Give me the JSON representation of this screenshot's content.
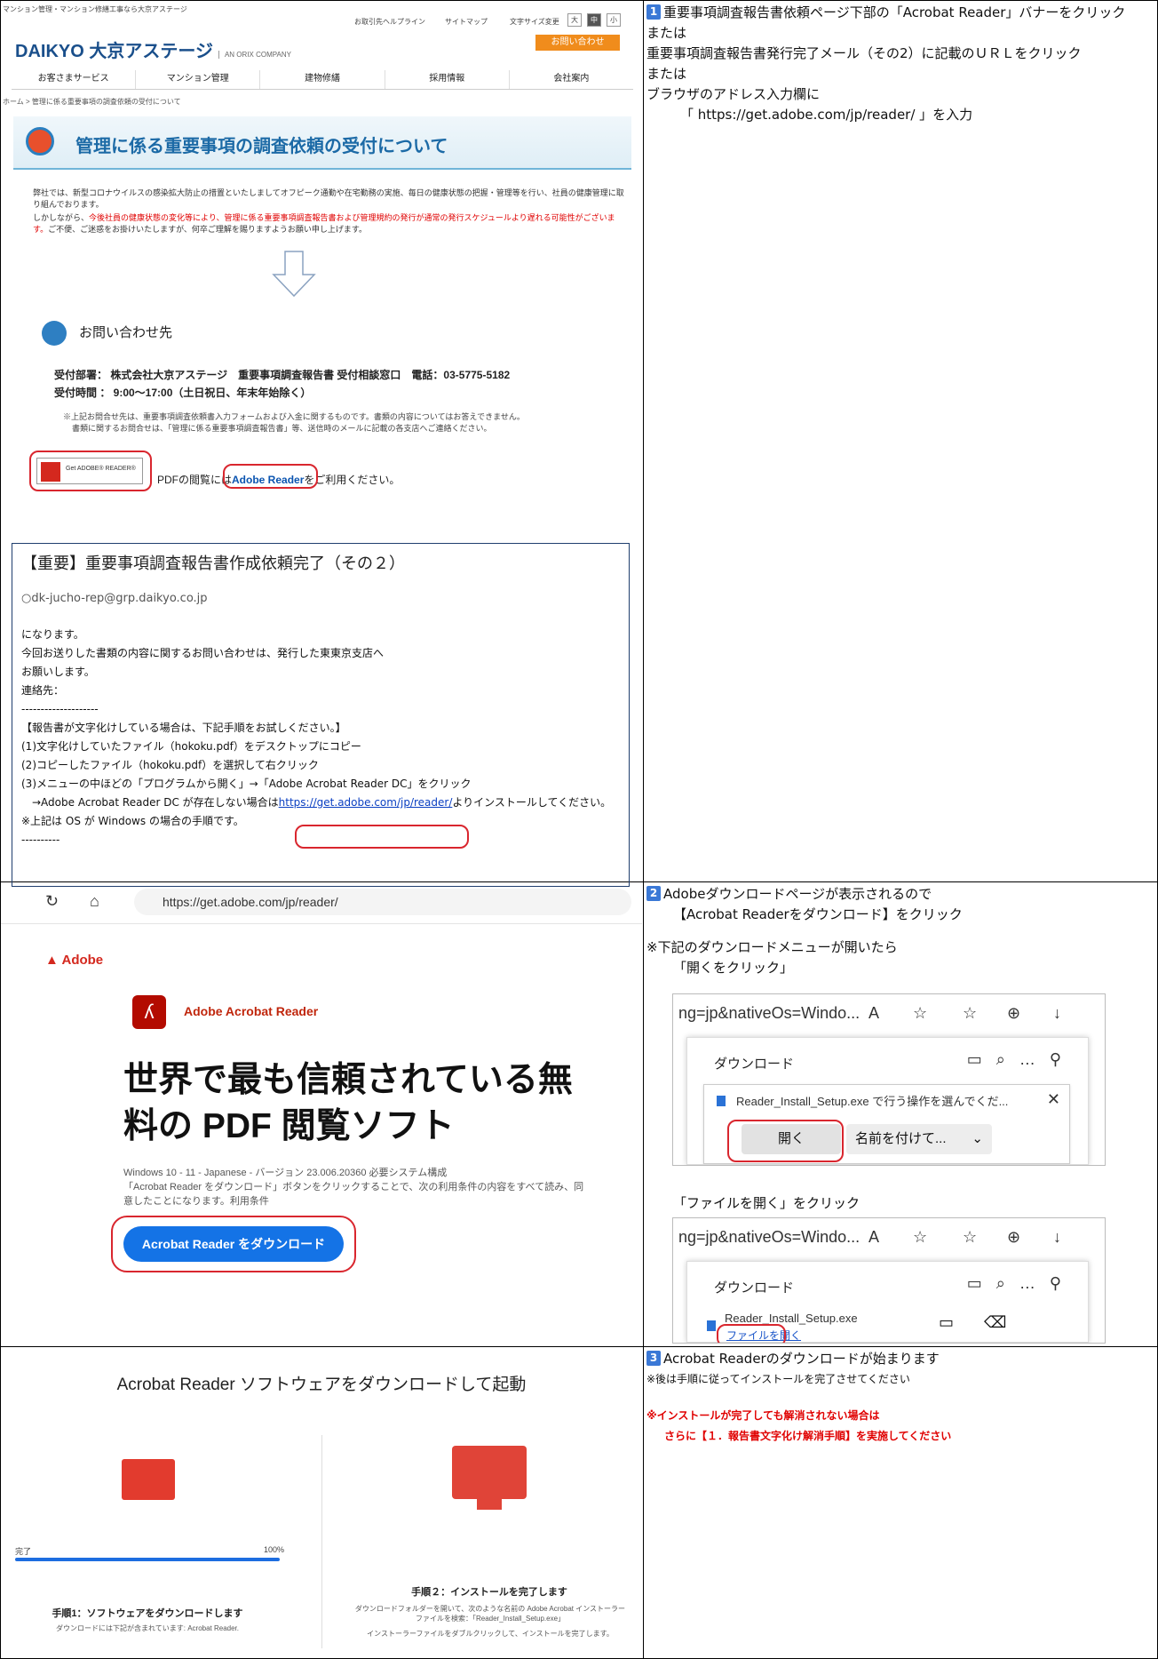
{
  "step1": {
    "num": "1",
    "line1": "重要事項調査報告書依頼ページ下部の「Acrobat Reader」バナーをクリック",
    "or1": "または",
    "line2": "重要事項調査報告書発行完了メール（その2）に記載のＵＲＬをクリック",
    "or2": "または",
    "line3": "ブラウザのアドレス入力欄に",
    "line4": "「 https://get.adobe.com/jp/reader/ 」を入力"
  },
  "step2": {
    "num": "2",
    "line1": "Adobeダウンロードページが表示されるので",
    "line2": "【Acrobat Readerをダウンロード】をクリック",
    "note": "※下記のダウンロードメニューが開いたら",
    "open_caption": "「開くをクリック」",
    "file_caption": "「ファイルを開く」をクリック"
  },
  "step3": {
    "num": "3",
    "line1": "Acrobat Readerのダウンロードが始まります",
    "line2": "※後は手順に従ってインストールを完了させてください",
    "warn1": "※インストールが完了しても解消されない場合は",
    "warn2": "さらに【１．報告書文字化け解消手順】を実施してください"
  },
  "daikyo": {
    "top_small": "マンション管理・マンション修繕工事なら大京アステージ",
    "help": "お取引先ヘルプライン",
    "sitemap": "サイトマップ",
    "fontsize": "文字サイズ変更",
    "size_l": "大",
    "size_m": "中",
    "size_s": "小",
    "logo": "DAIKYO 大京アステージ",
    "logo_sub": "AN ORIX COMPANY",
    "contact_btn": "お問い合わせ",
    "nav": [
      "お客さまサービス",
      "マンション管理",
      "建物修繕",
      "採用情報",
      "会社案内"
    ],
    "breadcrumb": "ホーム > 管理に係る重要事項の調査依頼の受付について",
    "title": "管理に係る重要事項の調査依頼の受付について",
    "para1": "弊社では、新型コロナウイルスの感染拡大防止の措置といたしましてオフピーク通勤や在宅勤務の実施、毎日の健康状態の把握・管理等を行い、社員の健康管理に取り組んでおります。",
    "para2_pre": "しかしながら、",
    "para2_red": "今後社員の健康状態の変化等により、管理に係る重要事項調査報告書および管理規約の発行が通常の発行スケジュールより遅れる可能性がございます。",
    "para2_post": "ご不便、ご迷惑をお掛けいたしますが、何卒ご理解を賜りますようお願い申し上げます。",
    "contact_head": "お問い合わせ先",
    "info1": "受付部署： 株式会社大京アステージ　重要事項調査報告書 受付相談窓口　電話：03-5775-5182",
    "info2": "受付時間 ： 9:00～17:00（土日祝日、年末年始除く）",
    "note1": "※上記お問合せ先は、重要事項調査依頼書入力フォームおよび入金に関するものです。書類の内容についてはお答えできません。",
    "note2": "書類に関するお問合せは、「管理に係る重要事項調査報告書」等、送信時のメールに記載の各支店へご連絡ください。",
    "get_reader": "Get ADOBE® READER®",
    "pdf_pre": "PDFの閲覧には",
    "pdf_link": "Adobe Reader",
    "pdf_post": "をご利用ください。"
  },
  "mail": {
    "subject": "【重要】重要事項調査報告書作成依頼完了（その２）",
    "from": "dk-jucho-rep@grp.daikyo.co.jp",
    "l1": "になります。",
    "l2": "今回お送りした書類の内容に関するお問い合わせは、発行した東東京支店へ",
    "l3": "お願いします。",
    "l4": "連絡先：",
    "l5": "--------------------",
    "l6": "【報告書が文字化けしている場合は、下記手順をお試しください。】",
    "l7": "(1)文字化けしていたファイル（hokoku.pdf）をデスクトップにコピー",
    "l8": "(2)コピーしたファイル（hokoku.pdf）を選択して右クリック",
    "l9": "(3)メニューの中ほどの「プログラムから開く」→「Adobe Acrobat Reader DC」をクリック",
    "l10_pre": "　→Adobe Acrobat Reader DC が存在しない場合は",
    "l10_link": "https://get.adobe.com/jp/reader/",
    "l10_post": "よりインストールしてください。",
    "l11": "※上記は OS が Windows の場合の手順です。",
    "l12": "----------"
  },
  "adobe": {
    "url": "https://get.adobe.com/jp/reader/",
    "brand": "Adobe",
    "product": "Adobe Acrobat Reader",
    "headline1": "世界で最も信頼されている無",
    "headline2": "料の PDF 閲覧ソフト",
    "meta1": "Windows 10 - 11 - Japanese - バージョン 23.006.20360  必要システム構成",
    "meta2": "「Acrobat Reader をダウンロード」ボタンをクリックすることで、次の利用条件の内容をすべて読み、同意したことになります。利用条件",
    "download_btn": "Acrobat Reader をダウンロード"
  },
  "dlpanel": {
    "addr": "ng=jp&nativeOs=Windo...",
    "title": "ダウンロード",
    "file_msg": "Reader_Install_Setup.exe で行う操作を選んでくだ...",
    "open_btn": "開く",
    "saveas_btn": "名前を付けて...",
    "file_name": "Reader_Install_Setup.exe",
    "open_file": "ファイルを開く"
  },
  "bottom": {
    "title": "Acrobat Reader ソフトウェアをダウンロードして起動",
    "done": "完了",
    "percent": "100%",
    "step1": "手順1：ソフトウェアをダウンロードします",
    "step1_desc": "ダウンロードには下記が含まれています: Acrobat Reader.",
    "step2": "手順２：インストールを完了します",
    "step2_desc": "ダウンロードフォルダーを開いて、次のような名前の Adobe Acrobat インストーラーファイルを検索：「Reader_Install_Setup.exe」",
    "step2_desc2": "インストーラーファイルをダブルクリックして、インストールを完了します。"
  }
}
